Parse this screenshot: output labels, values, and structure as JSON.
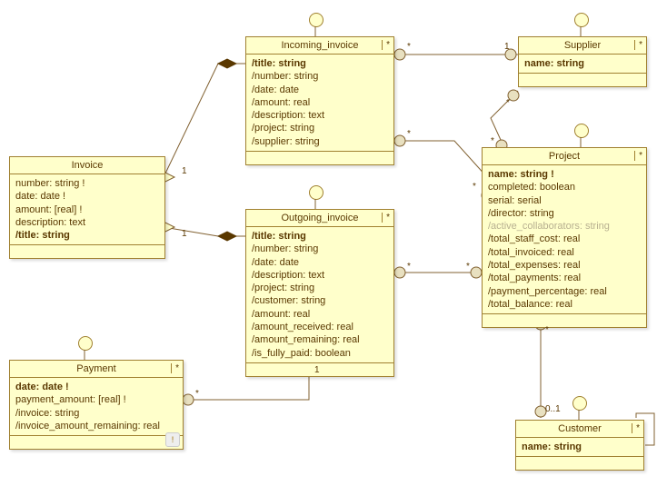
{
  "classes": {
    "invoice": {
      "name": "Invoice",
      "mult": "",
      "attrs": [
        {
          "text": "number: string !",
          "bold": false
        },
        {
          "text": "date: date !",
          "bold": false
        },
        {
          "text": "amount: [real] !",
          "bold": false
        },
        {
          "text": "description: text",
          "bold": false
        },
        {
          "text": "/title: string",
          "bold": true
        }
      ]
    },
    "incoming": {
      "name": "Incoming_invoice",
      "mult": "*",
      "attrs": [
        {
          "text": "/title: string",
          "bold": true
        },
        {
          "text": "/number: string",
          "bold": false
        },
        {
          "text": "/date: date",
          "bold": false
        },
        {
          "text": "/amount: real",
          "bold": false
        },
        {
          "text": "/description: text",
          "bold": false
        },
        {
          "text": "/project: string",
          "bold": false
        },
        {
          "text": "/supplier: string",
          "bold": false
        }
      ]
    },
    "outgoing": {
      "name": "Outgoing_invoice",
      "mult": "*",
      "attrs": [
        {
          "text": "/title: string",
          "bold": true
        },
        {
          "text": "/number: string",
          "bold": false
        },
        {
          "text": "/date: date",
          "bold": false
        },
        {
          "text": "/description: text",
          "bold": false
        },
        {
          "text": "/project: string",
          "bold": false
        },
        {
          "text": "/customer: string",
          "bold": false
        },
        {
          "text": "/amount: real",
          "bold": false
        },
        {
          "text": "/amount_received: real",
          "bold": false
        },
        {
          "text": "/amount_remaining: real",
          "bold": false
        },
        {
          "text": "/is_fully_paid: boolean",
          "bold": false
        }
      ]
    },
    "payment": {
      "name": "Payment",
      "mult": "*",
      "attrs": [
        {
          "text": "date: date !",
          "bold": true
        },
        {
          "text": "payment_amount: [real] !",
          "bold": false
        },
        {
          "text": "/invoice: string",
          "bold": false
        },
        {
          "text": "/invoice_amount_remaining: real",
          "bold": false
        }
      ]
    },
    "supplier": {
      "name": "Supplier",
      "mult": "*",
      "attrs": [
        {
          "text": "name: string",
          "bold": true
        }
      ]
    },
    "project": {
      "name": "Project",
      "mult": "*",
      "attrs": [
        {
          "text": "name: string !",
          "bold": true
        },
        {
          "text": "completed: boolean",
          "bold": false
        },
        {
          "text": "serial: serial",
          "bold": false
        },
        {
          "text": "/director: string",
          "bold": false
        },
        {
          "text": "/active_collaborators: string",
          "bold": false,
          "faded": true
        },
        {
          "text": "/total_staff_cost: real",
          "bold": false
        },
        {
          "text": "/total_invoiced: real",
          "bold": false
        },
        {
          "text": "/total_expenses: real",
          "bold": false
        },
        {
          "text": "/total_payments: real",
          "bold": false
        },
        {
          "text": "/payment_percentage: real",
          "bold": false
        },
        {
          "text": "/total_balance: real",
          "bold": false
        }
      ]
    },
    "customer": {
      "name": "Customer",
      "mult": "*",
      "attrs": [
        {
          "text": "name: string",
          "bold": true
        }
      ]
    }
  },
  "multiplicities": {
    "inv_inc": "1",
    "inv_out": "1",
    "inc_sup_l": "*",
    "inc_sup_r": "1",
    "inc_prj_l": "*",
    "inc_prj_r": "*",
    "out_prj_l": "*",
    "out_prj_r": "*",
    "out_pay": "1",
    "pay_out": "*",
    "cus_prj": "*",
    "prj_cus": "0..1",
    "sup_prj": "*",
    "prj_sup": "*"
  },
  "chart_data": {
    "type": "table",
    "description": "UML class diagram",
    "classes": [
      {
        "name": "Invoice",
        "attributes": [
          "number: string !",
          "date: date !",
          "amount: [real] !",
          "description: text",
          "/title: string"
        ]
      },
      {
        "name": "Incoming_invoice",
        "attributes": [
          "/title: string",
          "/number: string",
          "/date: date",
          "/amount: real",
          "/description: text",
          "/project: string",
          "/supplier: string"
        ]
      },
      {
        "name": "Outgoing_invoice",
        "attributes": [
          "/title: string",
          "/number: string",
          "/date: date",
          "/description: text",
          "/project: string",
          "/customer: string",
          "/amount: real",
          "/amount_received: real",
          "/amount_remaining: real",
          "/is_fully_paid: boolean"
        ]
      },
      {
        "name": "Payment",
        "attributes": [
          "date: date !",
          "payment_amount: [real] !",
          "/invoice: string",
          "/invoice_amount_remaining: real"
        ]
      },
      {
        "name": "Supplier",
        "attributes": [
          "name: string"
        ]
      },
      {
        "name": "Project",
        "attributes": [
          "name: string !",
          "completed: boolean",
          "serial: serial",
          "/director: string",
          "/active_collaborators: string",
          "/total_staff_cost: real",
          "/total_invoiced: real",
          "/total_expenses: real",
          "/total_payments: real",
          "/payment_percentage: real",
          "/total_balance: real"
        ]
      },
      {
        "name": "Customer",
        "attributes": [
          "name: string"
        ]
      }
    ],
    "relations": [
      {
        "from": "Incoming_invoice",
        "to": "Invoice",
        "type": "extension/composition",
        "mult_from": "",
        "mult_to": "1"
      },
      {
        "from": "Outgoing_invoice",
        "to": "Invoice",
        "type": "extension/composition",
        "mult_from": "",
        "mult_to": "1"
      },
      {
        "from": "Incoming_invoice",
        "to": "Supplier",
        "type": "association",
        "mult_from": "*",
        "mult_to": "1"
      },
      {
        "from": "Incoming_invoice",
        "to": "Project",
        "type": "association",
        "mult_from": "*",
        "mult_to": "*"
      },
      {
        "from": "Outgoing_invoice",
        "to": "Project",
        "type": "association",
        "mult_from": "*",
        "mult_to": "*"
      },
      {
        "from": "Outgoing_invoice",
        "to": "Payment",
        "type": "composition",
        "mult_from": "1",
        "mult_to": "*"
      },
      {
        "from": "Project",
        "to": "Customer",
        "type": "association",
        "mult_from": "*",
        "mult_to": "0..1"
      },
      {
        "from": "Supplier",
        "to": "Project",
        "type": "association",
        "mult_from": "*",
        "mult_to": "*"
      },
      {
        "from": "Customer",
        "to": "Customer",
        "type": "self-association",
        "mult_from": "",
        "mult_to": ""
      }
    ]
  }
}
